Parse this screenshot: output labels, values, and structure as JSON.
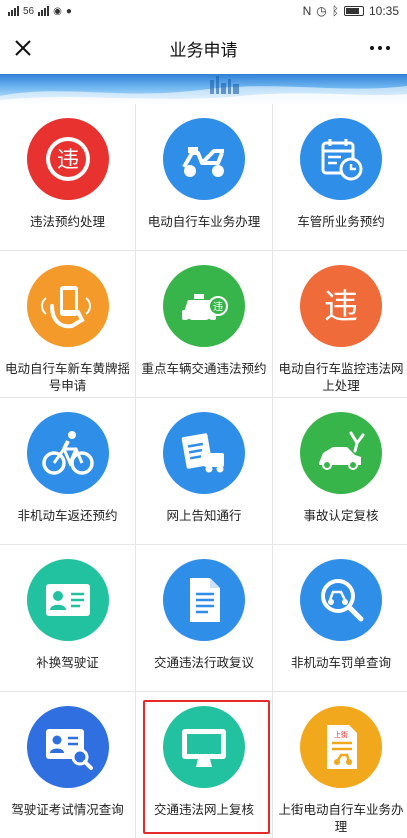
{
  "statusbar": {
    "left_text": "56",
    "battery": "80",
    "time": "10:35"
  },
  "navbar": {
    "title": "业务申请"
  },
  "colors": {
    "red": "#e8322f",
    "blue": "#2f8ee8",
    "orange": "#f49a2a",
    "green": "#38b54a",
    "teal": "#22c19f",
    "highlight": "#e42a2a"
  },
  "services": [
    {
      "label": "违法预约处理",
      "icon": "violation-char-icon"
    },
    {
      "label": "电动自行车业务办理",
      "icon": "scooter-icon"
    },
    {
      "label": "车管所业务预约",
      "icon": "calendar-clock-icon"
    },
    {
      "label": "电动自行车新车黄牌摇号申请",
      "icon": "hand-phone-icon"
    },
    {
      "label": "重点车辆交通违法预约",
      "icon": "car-violation-icon"
    },
    {
      "label": "电动自行车监控违法网上处理",
      "icon": "violation-char-icon"
    },
    {
      "label": "非机动车返还预约",
      "icon": "bicycle-icon"
    },
    {
      "label": "网上告知通行",
      "icon": "license-truck-icon"
    },
    {
      "label": "事故认定复核",
      "icon": "accident-icon"
    },
    {
      "label": "补换驾驶证",
      "icon": "id-card-icon"
    },
    {
      "label": "交通违法行政复议",
      "icon": "document-icon"
    },
    {
      "label": "非机动车罚单查询",
      "icon": "search-scooter-icon"
    },
    {
      "label": "驾驶证考试情况查询",
      "icon": "id-search-icon"
    },
    {
      "label": "交通违法网上复核",
      "icon": "monitor-icon"
    },
    {
      "label": "上街电动自行车业务办理",
      "icon": "doc-scooter-icon"
    }
  ],
  "icon_glyphs": {
    "violation": "违",
    "car_badge": "违",
    "doc_tag": "上街"
  }
}
